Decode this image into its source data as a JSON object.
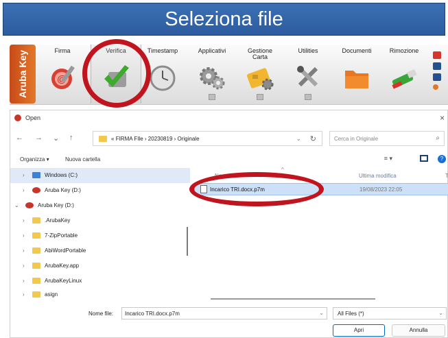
{
  "banner": {
    "title": "Seleziona file"
  },
  "toolbar": {
    "brand": "Aruba Key",
    "items": [
      {
        "label": "Firma",
        "icon": "signature-seal-icon"
      },
      {
        "label": "Verifica",
        "icon": "checkmark-icon"
      },
      {
        "label": "Timestamp",
        "icon": "clock-icon"
      },
      {
        "label": "Applicativi",
        "icon": "gears-icon"
      },
      {
        "label": "Gestione\nCarta",
        "icon": "smartcard-gear-icon"
      },
      {
        "label": "Utilities",
        "icon": "tools-icon"
      },
      {
        "label": "Documenti",
        "icon": "folder-icon"
      },
      {
        "label": "Rimozione",
        "icon": "usb-key-remove-icon"
      }
    ],
    "highlight_color": "#c0141e"
  },
  "dialog": {
    "title": "Open",
    "close": "×",
    "nav": {
      "back": "←",
      "forward": "→",
      "recent": "⌄",
      "up": "↑"
    },
    "address": {
      "prefix": "«",
      "path": "FIRMA FIle  ›  20230819  ›  Originale",
      "chevron": "⌄",
      "refresh": "↻"
    },
    "search": {
      "placeholder": "Cerca in Originale",
      "icon": "⌕"
    },
    "commands": {
      "organize": "Organizza ▾",
      "new_folder": "Nuova cartella",
      "view": "≡ ▾",
      "help": "?"
    },
    "tree": [
      {
        "label": "Windows (C:)",
        "caret": "›",
        "kind": "drive",
        "selected": true
      },
      {
        "label": "Aruba Key (D:)",
        "caret": "›",
        "kind": "usb"
      },
      {
        "label": "Aruba Key (D:)",
        "caret": "⌄",
        "kind": "usb"
      },
      {
        "label": ".ArubaKey",
        "caret": "›",
        "kind": "folder"
      },
      {
        "label": "7-ZipPortable",
        "caret": "›",
        "kind": "folder"
      },
      {
        "label": "AbiWordPortable",
        "caret": "›",
        "kind": "folder"
      },
      {
        "label": "ArubaKey.app",
        "caret": "›",
        "kind": "folder"
      },
      {
        "label": "ArubaKeyLinux",
        "caret": "›",
        "kind": "folder"
      },
      {
        "label": "asign",
        "caret": "›",
        "kind": "folder"
      }
    ],
    "columns": {
      "name": "Nome",
      "modified": "Ultima modifica",
      "type": "T",
      "sort": "^"
    },
    "files": [
      {
        "name": "Incarico TRI.docx.p7m",
        "modified": "19/08/2023 22:05"
      }
    ],
    "filename_label": "Nome file:",
    "filename_value": "Incarico TRI.docx.p7m",
    "filetype": "All Files (*)",
    "dropdown": "⌄",
    "open_label": "Apri",
    "cancel_label": "Annulla"
  }
}
